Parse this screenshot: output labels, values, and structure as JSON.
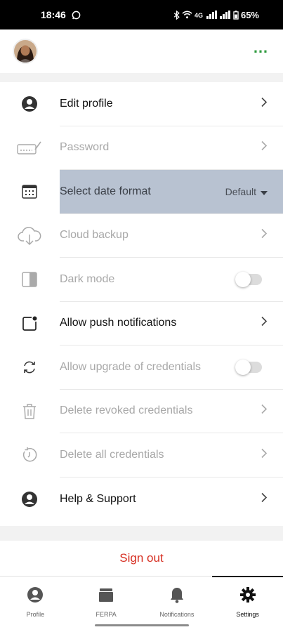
{
  "status": {
    "time": "18:46",
    "battery": "65%"
  },
  "settings": {
    "items": [
      {
        "label": "Edit profile",
        "icon": "person-icon",
        "state": "enabled",
        "control": "chevron"
      },
      {
        "label": "Password",
        "icon": "keyboard-pen-icon",
        "state": "disabled",
        "control": "chevron"
      },
      {
        "label": "Select date format",
        "icon": "calendar-icon",
        "state": "highlighted",
        "control": "select",
        "value": "Default"
      },
      {
        "label": "Cloud backup",
        "icon": "cloud-download-icon",
        "state": "disabled",
        "control": "chevron"
      },
      {
        "label": "Dark mode",
        "icon": "contrast-icon",
        "state": "disabled",
        "control": "toggle",
        "on": false
      },
      {
        "label": "Allow push notifications",
        "icon": "notification-dot-icon",
        "state": "enabled",
        "control": "chevron"
      },
      {
        "label": "Allow upgrade of credentials",
        "icon": "sync-icon",
        "state": "disabled",
        "control": "toggle",
        "on": false
      },
      {
        "label": "Delete revoked credentials",
        "icon": "trash-icon",
        "state": "disabled",
        "control": "chevron"
      },
      {
        "label": "Delete all credentials",
        "icon": "reset-icon",
        "state": "disabled",
        "control": "chevron"
      },
      {
        "label": "Help & Support",
        "icon": "person-icon",
        "state": "enabled",
        "control": "chevron"
      }
    ]
  },
  "sign_out": "Sign out",
  "tabs": [
    {
      "label": "Profile",
      "icon": "person-icon",
      "active": false
    },
    {
      "label": "FERPA",
      "icon": "folder-icon",
      "active": false
    },
    {
      "label": "Notifications",
      "icon": "bell-icon",
      "active": false
    },
    {
      "label": "Settings",
      "icon": "gear-icon",
      "active": true
    }
  ],
  "colors": {
    "accent_green": "#2e9a3e",
    "signout_red": "#d62c1f",
    "highlight": "#b8c2d1"
  }
}
